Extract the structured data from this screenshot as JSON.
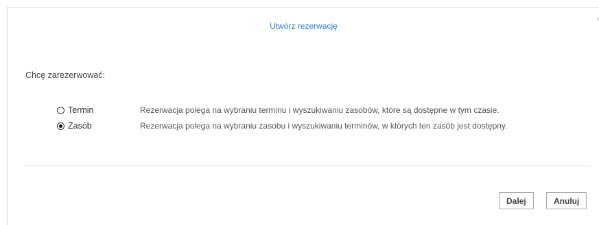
{
  "dialog": {
    "title": "Utwórz rezerwację",
    "close_glyph": "×",
    "prompt": "Chcę zarezerwować:",
    "options": [
      {
        "label": "Termin",
        "selected": false,
        "description": "Rezerwacja polega na wybraniu terminu i wyszukiwaniu zasobów, które są dostępne w tym czasie."
      },
      {
        "label": "Zasób",
        "selected": true,
        "description": "Rezerwacja polega na wybraniu zasobu i wyszukiwaniu terminów, w których ten zasób jest dostępny."
      }
    ],
    "buttons": {
      "next_label": "Dalej",
      "cancel_label": "Anuluj"
    }
  },
  "colors": {
    "title": "#2b7bd4",
    "text": "#444444",
    "border": "#d6d6d6"
  }
}
